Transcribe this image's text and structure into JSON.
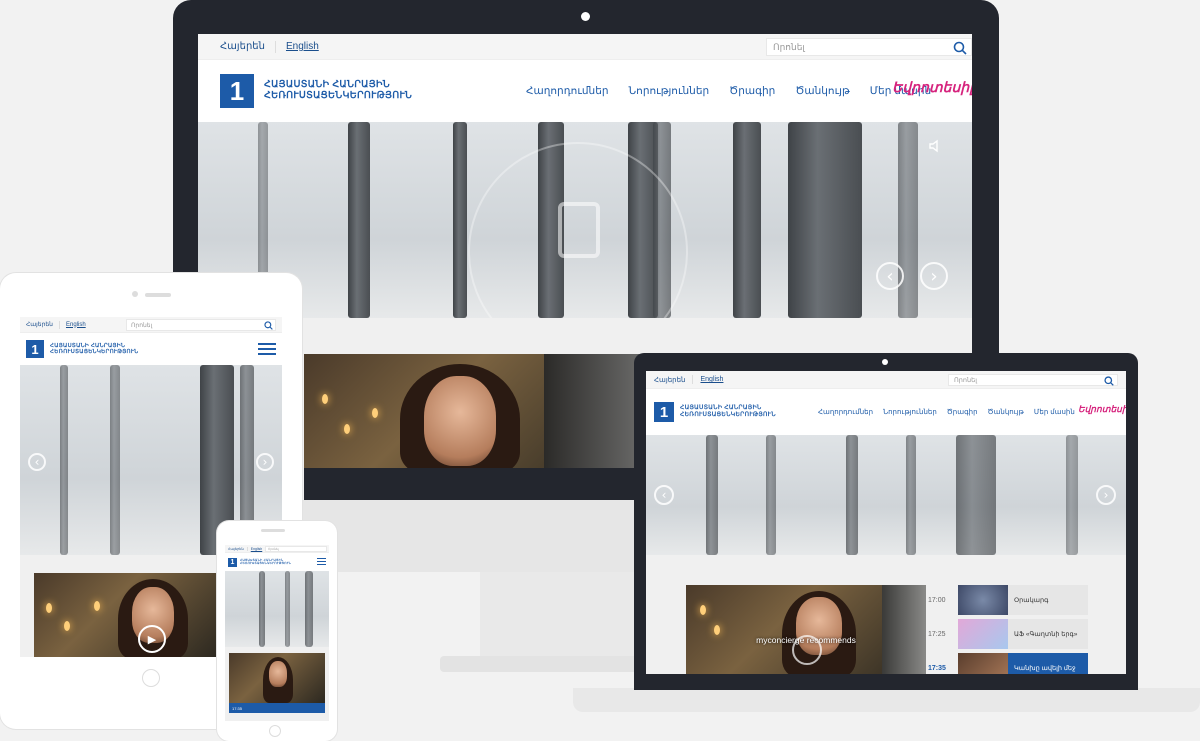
{
  "site": {
    "lang_hy": "Հայերեն",
    "lang_en": "English",
    "search_placeholder": "Որոնել",
    "logo_mark": "1",
    "logo_line1": "ՀԱՅԱՍՏԱՆԻ ՀԱՆՐԱՅԻՆ",
    "logo_line2": "ՀԵՌՈՒՍՏԱՑԵՆԿԵՐՈՒԹՅՈՒՆ",
    "nav": [
      "Հաղորդումներ",
      "Նորություններ",
      "Ծրագիր",
      "Ծանկույթ",
      "Մեր մասին"
    ],
    "brand_badge": "Եվրոտեսիլ",
    "arrow_prev": "‹",
    "arrow_next": "›",
    "sound_icon": "speaker-icon"
  },
  "laptop": {
    "video_caption": "myconcierge recommends",
    "schedule": [
      {
        "time": "17:00",
        "title": "Օրակարգ"
      },
      {
        "time": "17:25",
        "title": "ԱՖ «Գաղտնի երգ»"
      },
      {
        "time": "17:35",
        "title": "Կանխը ավելի մեջ"
      }
    ]
  },
  "phone": {
    "schedule_time": "17:35"
  },
  "colors": {
    "brand_blue": "#1d5ba8",
    "device_dark": "#23262e",
    "badge_pink": "#d6237d",
    "schedule_active": "#1d5ba8"
  }
}
